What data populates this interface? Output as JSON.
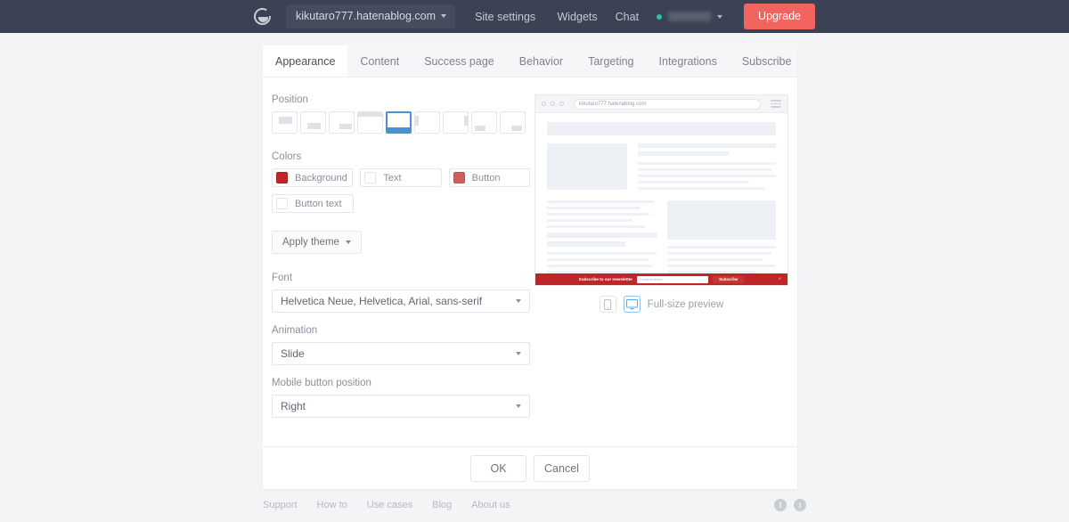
{
  "topnav": {
    "logo_icon": "sumo-circle-logo",
    "site_name": "kikutaro777.hatenablog.com",
    "site_settings_label": "Site settings",
    "widgets_label": "Widgets",
    "chat_label": "Chat",
    "upgrade_label": "Upgrade",
    "user_status": "online",
    "background_color": "#3b4253",
    "upgrade_color": "#f1645f"
  },
  "tabs": [
    {
      "label": "Appearance",
      "active": true
    },
    {
      "label": "Content",
      "active": false
    },
    {
      "label": "Success page",
      "active": false
    },
    {
      "label": "Behavior",
      "active": false
    },
    {
      "label": "Targeting",
      "active": false
    },
    {
      "label": "Integrations",
      "active": false
    }
  ],
  "tab_right": {
    "label": "Subscribe"
  },
  "appearance": {
    "position": {
      "label": "Position",
      "selected_index": 4,
      "options": [
        "top-center-box",
        "bottom-center-box",
        "bottom-right-box",
        "top-bar",
        "bottom-bar",
        "left-side-tab",
        "right-side-tab",
        "bottom-left-corner",
        "bottom-right-corner"
      ]
    },
    "colors": {
      "label": "Colors",
      "items": [
        {
          "name": "Background",
          "value": "#bf2626"
        },
        {
          "name": "Text",
          "value": "#ffffff"
        },
        {
          "name": "Button",
          "value": "#d1605b"
        },
        {
          "name": "Button text",
          "value": "#ffffff"
        }
      ]
    },
    "apply_theme_label": "Apply theme",
    "font": {
      "label": "Font",
      "value": "Helvetica Neue, Helvetica, Arial, sans-serif"
    },
    "animation": {
      "label": "Animation",
      "value": "Slide"
    },
    "mobile_button_position": {
      "label": "Mobile button position",
      "value": "Right"
    }
  },
  "preview": {
    "url": "kikutaro777.hatenablog.com",
    "bottom_bar": {
      "headline": "Subscribe to our newsletter",
      "email_placeholder": "Email address",
      "button_label": "Subscribe",
      "close_label": "×",
      "background_color": "#bf2626",
      "button_color": "#c1392f"
    },
    "device_mobile_icon": "mobile-device-icon",
    "device_desktop_icon": "desktop-monitor-icon",
    "full_size_label": "Full-size preview"
  },
  "dialog_actions": {
    "ok_label": "OK",
    "cancel_label": "Cancel"
  },
  "footer": {
    "links": [
      "Support",
      "How to",
      "Use cases",
      "Blog",
      "About us"
    ],
    "social": [
      {
        "icon": "facebook-icon",
        "glyph": "f"
      },
      {
        "icon": "twitter-icon",
        "glyph": "t"
      }
    ]
  }
}
